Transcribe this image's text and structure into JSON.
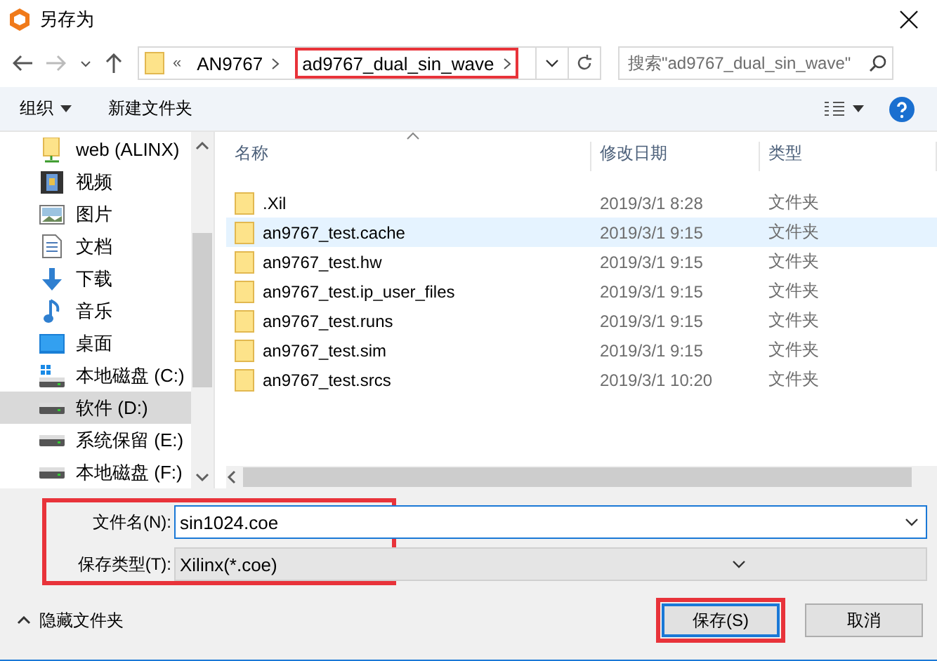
{
  "window": {
    "title": "另存为"
  },
  "address": {
    "crumbs": [
      {
        "label": "AN9767",
        "highlighted": false
      },
      {
        "label": "ad9767_dual_sin_wave",
        "highlighted": true
      }
    ],
    "overflow": "«"
  },
  "search": {
    "placeholder": "搜索\"ad9767_dual_sin_wave\""
  },
  "toolbar": {
    "items": [
      {
        "label": "组织",
        "dropdown": true
      },
      {
        "label": "新建文件夹",
        "dropdown": false
      }
    ]
  },
  "sidebar": {
    "items": [
      {
        "label": "web (ALINX)",
        "kind": "netdrive",
        "selected": false
      },
      {
        "label": "视频",
        "kind": "video",
        "selected": false
      },
      {
        "label": "图片",
        "kind": "picture",
        "selected": false
      },
      {
        "label": "文档",
        "kind": "document",
        "selected": false
      },
      {
        "label": "下载",
        "kind": "download",
        "selected": false
      },
      {
        "label": "音乐",
        "kind": "music",
        "selected": false
      },
      {
        "label": "桌面",
        "kind": "desktop",
        "selected": false
      },
      {
        "label": "本地磁盘 (C:)",
        "kind": "sysdrive",
        "selected": false
      },
      {
        "label": "软件 (D:)",
        "kind": "drive",
        "selected": true
      },
      {
        "label": "系统保留 (E:)",
        "kind": "drive",
        "selected": false
      },
      {
        "label": "本地磁盘 (F:)",
        "kind": "drive",
        "selected": false
      }
    ]
  },
  "table": {
    "columns": [
      "名称",
      "修改日期",
      "类型"
    ],
    "rows": [
      {
        "name": ".Xil",
        "date": "2019/3/1 8:28",
        "type": "文件夹",
        "hovered": false
      },
      {
        "name": "an9767_test.cache",
        "date": "2019/3/1 9:15",
        "type": "文件夹",
        "hovered": true
      },
      {
        "name": "an9767_test.hw",
        "date": "2019/3/1 9:15",
        "type": "文件夹",
        "hovered": false
      },
      {
        "name": "an9767_test.ip_user_files",
        "date": "2019/3/1 9:15",
        "type": "文件夹",
        "hovered": false
      },
      {
        "name": "an9767_test.runs",
        "date": "2019/3/1 9:15",
        "type": "文件夹",
        "hovered": false
      },
      {
        "name": "an9767_test.sim",
        "date": "2019/3/1 9:15",
        "type": "文件夹",
        "hovered": false
      },
      {
        "name": "an9767_test.srcs",
        "date": "2019/3/1 10:20",
        "type": "文件夹",
        "hovered": false
      }
    ]
  },
  "form": {
    "highlighted": true,
    "fields": [
      {
        "label": "文件名(N):",
        "value": "sin1024.coe",
        "kind": "input"
      },
      {
        "label": "保存类型(T):",
        "value": "Xilinx(*.coe)",
        "kind": "select"
      }
    ]
  },
  "footer": {
    "toggle": "隐藏文件夹",
    "buttons": [
      {
        "label": "保存(S)",
        "default": true,
        "highlighted": true
      },
      {
        "label": "取消",
        "default": false,
        "highlighted": false
      }
    ]
  }
}
